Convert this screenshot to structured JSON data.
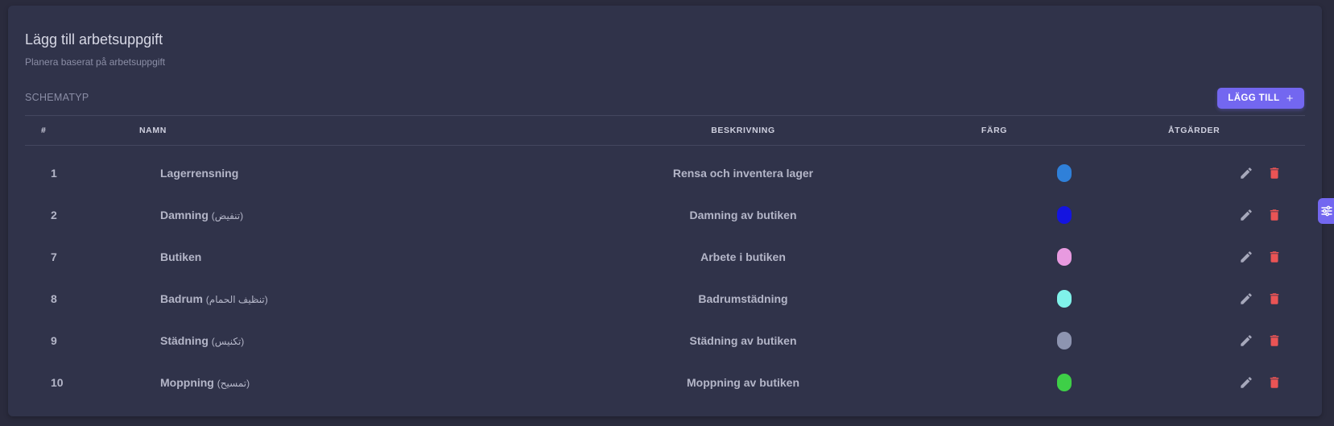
{
  "header": {
    "title": "Lägg till arbetsuppgift",
    "subtitle": "Planera baserat på arbetsuppgift"
  },
  "section": {
    "label": "SCHEMATYP",
    "add_button_label": "LÄGG TILL"
  },
  "table": {
    "columns": {
      "num": "#",
      "name": "NAMN",
      "description": "BESKRIVNING",
      "color": "FÄRG",
      "actions": "ÅTGÄRDER"
    },
    "rows": [
      {
        "num": "1",
        "name": "Lagerrensning",
        "name_extra": "",
        "description": "Rensa och inventera lager",
        "color": "#2f80d9"
      },
      {
        "num": "2",
        "name": "Damning",
        "name_extra": "(تنفيض)",
        "description": "Damning av butiken",
        "color": "#1414e0"
      },
      {
        "num": "7",
        "name": "Butiken",
        "name_extra": "",
        "description": "Arbete i butiken",
        "color": "#e89ae0"
      },
      {
        "num": "8",
        "name": "Badrum",
        "name_extra": "(تنظيف الحمام)",
        "description": "Badrumstädning",
        "color": "#80f2ea"
      },
      {
        "num": "9",
        "name": "Städning",
        "name_extra": "(تكنيس)",
        "description": "Städning av butiken",
        "color": "#8d94b0"
      },
      {
        "num": "10",
        "name": "Moppning",
        "name_extra": "(تمسيح)",
        "description": "Moppning av butiken",
        "color": "#3ecf47"
      }
    ]
  },
  "colors": {
    "accent": "#7367f0",
    "delete": "#ea5455",
    "edit": "#a6a8bb"
  },
  "icons": {
    "edit": "pencil-icon",
    "delete": "trash-icon",
    "add": "plus-icon",
    "settings": "sliders-icon"
  }
}
